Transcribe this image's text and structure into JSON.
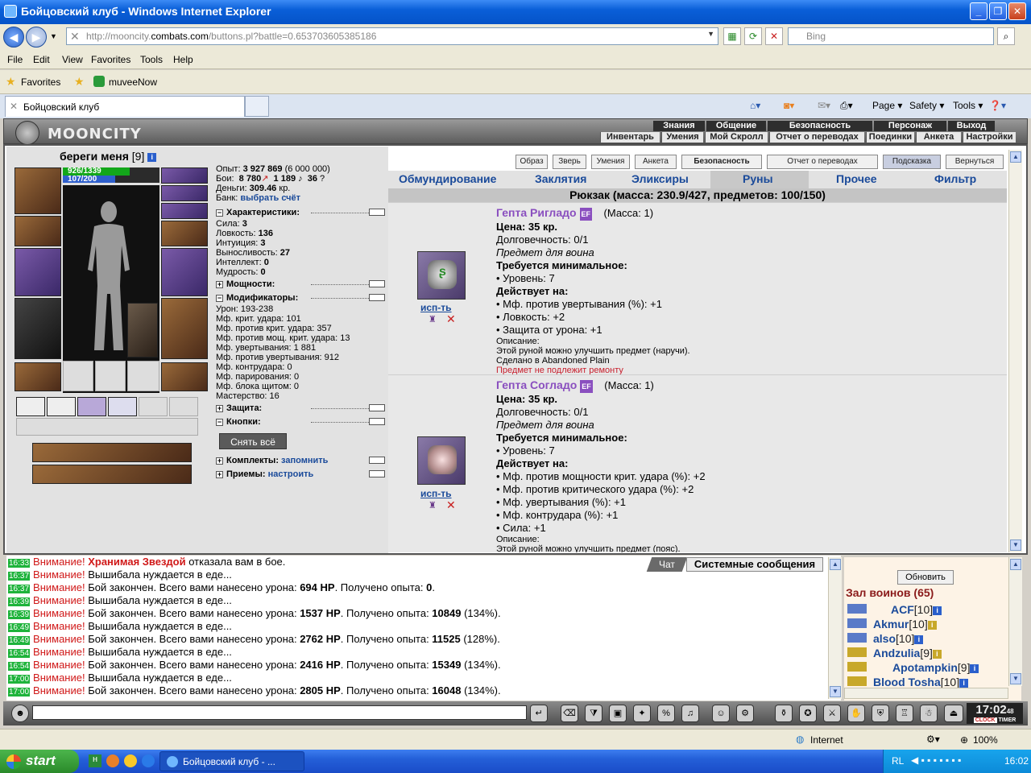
{
  "window": {
    "title": "Бойцовский клуб - Windows Internet Explorer",
    "min": "_",
    "max": "❐",
    "close": "✕"
  },
  "browser": {
    "url_prefix": "http://mooncity.",
    "url_domain": "combats.com",
    "url_suffix": "/buttons.pl?battle=0.653703605385186",
    "search_placeholder": "Bing",
    "menu": [
      "File",
      "Edit",
      "View",
      "Favorites",
      "Tools",
      "Help"
    ],
    "favorites_label": "Favorites",
    "fav_link": "muveeNow",
    "tab_title": "Бойцовский клуб",
    "cmd": [
      "Page ▾",
      "Safety ▾",
      "Tools ▾"
    ],
    "status_zone": "Internet",
    "zoom": "100%"
  },
  "game_header": {
    "logo": "MOONCITY",
    "top_menu": [
      "Знания",
      "Общение",
      "Безопасность",
      "Персонаж",
      "Выход"
    ],
    "sub_menu": [
      "Инвентарь",
      "Умения",
      "Отчет о переводах",
      "Анкета",
      "Настройки"
    ],
    "sub_menu2": [
      "Мой Скролл",
      "Поединки"
    ]
  },
  "character": {
    "nick": "береги меня",
    "level": "[9]",
    "hp": "926/1339",
    "mp": "107/200",
    "hp_fraction": 0.69,
    "mp_fraction": 0.54
  },
  "stats": {
    "exp_label": "Опыт:",
    "exp_value": "3 927 869",
    "exp_next": "(6 000 000)",
    "fights_label": "Бои:",
    "wins": "8 780",
    "losses": "1 189",
    "draws": "36",
    "money_label": "Деньги:",
    "money": "309.46",
    "money_unit": "кр.",
    "bank_label": "Банк:",
    "bank_link": "выбрать счёт",
    "sec_chars": "Характеристики:",
    "attrs": [
      {
        "label": "Сила:",
        "value": "3"
      },
      {
        "label": "Ловкость:",
        "value": "136"
      },
      {
        "label": "Интуиция:",
        "value": "3"
      },
      {
        "label": "Выносливость:",
        "value": "27"
      },
      {
        "label": "Интеллект:",
        "value": "0"
      },
      {
        "label": "Мудрость:",
        "value": "0"
      }
    ],
    "sec_power": "Мощности:",
    "sec_mods": "Модификаторы:",
    "mods": [
      "Урон: 193-238",
      "Мф. крит. удара: 101",
      "Мф. против крит. удара: 357",
      "Мф. против мощ. крит. удара: 13",
      "Мф. увертывания: 1 881",
      "Мф. против увертывания: 912",
      "Мф. контрудара: 0",
      "Мф. парирования: 0",
      "Мф. блока щитом: 0",
      "Мастерство: 16"
    ],
    "sec_defense": "Защита:",
    "sec_buttons": "Кнопки:",
    "takeoff": "Снять всё",
    "sec_sets": "Комплекты:",
    "sets_link": "запомнить",
    "sec_moves": "Приемы:",
    "moves_link": "настроить"
  },
  "top_buttons": [
    "Образ",
    "Зверь",
    "Умения",
    "Анкета",
    "Безопасность",
    "Отчет о переводах",
    "Подсказка",
    "Вернуться"
  ],
  "categories": [
    "Обмундирование",
    "Заклятия",
    "Эликсиры",
    "Руны",
    "Прочее",
    "Фильтр"
  ],
  "backpack": "Рюкзак (масса: 230.9/427, предметов: 100/150)",
  "items": [
    {
      "name": "Гепта Ригладо",
      "badge": "EF",
      "mass": "(Масса: 1)",
      "price": "Цена: 35 кр.",
      "durability": "Долговечность: 0/1",
      "for": "Предмет для воина",
      "req_head": "Требуется минимальное:",
      "req": [
        "• Уровень: 7"
      ],
      "acts_head": "Действует на:",
      "acts": [
        "• Мф. против увертывания (%): +1",
        "• Ловкость: +2",
        "• Защита от урона: +1"
      ],
      "desc_head": "Описание:",
      "desc": "Этой руной можно улучшить предмет (наручи).",
      "made": "Сделано в Abandoned Plain",
      "note": "Предмет не подлежит ремонту",
      "use": "исп-ть"
    },
    {
      "name": "Гепта Согладо",
      "badge": "EF",
      "mass": "(Масса: 1)",
      "price": "Цена: 35 кр.",
      "durability": "Долговечность: 0/1",
      "for": "Предмет для воина",
      "req_head": "Требуется минимальное:",
      "req": [
        "• Уровень: 7"
      ],
      "acts_head": "Действует на:",
      "acts": [
        "• Мф. против мощности крит. удара (%): +2",
        "• Мф. против критического удара (%): +2",
        "• Мф. увертывания (%): +1",
        "• Мф. контрудара (%): +1",
        "• Сила: +1"
      ],
      "desc_head": "Описание:",
      "desc": "Этой руной можно улучшить предмет (пояс).",
      "use": "исп-ть"
    }
  ],
  "chat": {
    "tab_chat": "Чат",
    "tab_system": "Системные сообщения",
    "messages": [
      {
        "time": "16:33",
        "warn": "Внимание!",
        "boss": "Хранимая Звездой",
        "text": " отказала вам в бое."
      },
      {
        "time": "16:37",
        "warn": "Внимание!",
        "text": " Вышибала нуждается в еде..."
      },
      {
        "time": "16:37",
        "warn": "Внимание!",
        "text": " Бой закончен. Всего вами нанесено урона: ",
        "dmg": "694 HP",
        "mid": ". Получено опыта: ",
        "exp": "0",
        "tail": "."
      },
      {
        "time": "16:39",
        "warn": "Внимание!",
        "text": " Вышибала нуждается в еде..."
      },
      {
        "time": "16:39",
        "warn": "Внимание!",
        "text": " Бой закончен. Всего вами нанесено урона: ",
        "dmg": "1537 HP",
        "mid": ". Получено опыта: ",
        "exp": "10849",
        "tail": " (134%)."
      },
      {
        "time": "16:49",
        "warn": "Внимание!",
        "text": " Вышибала нуждается в еде..."
      },
      {
        "time": "16:49",
        "warn": "Внимание!",
        "text": " Бой закончен. Всего вами нанесено урона: ",
        "dmg": "2762 HP",
        "mid": ". Получено опыта: ",
        "exp": "11525",
        "tail": " (128%)."
      },
      {
        "time": "16:54",
        "warn": "Внимание!",
        "text": " Вышибала нуждается в еде..."
      },
      {
        "time": "16:54",
        "warn": "Внимание!",
        "text": " Бой закончен. Всего вами нанесено урона: ",
        "dmg": "2416 HP",
        "mid": ". Получено опыта: ",
        "exp": "15349",
        "tail": " (134%)."
      },
      {
        "time": "17:00",
        "warn": "Внимание!",
        "text": " Вышибала нуждается в еде..."
      },
      {
        "time": "17:00",
        "warn": "Внимание!",
        "text": " Бой закончен. Всего вами нанесено урона: ",
        "dmg": "2805 HP",
        "mid": ". Получено опыта: ",
        "exp": "16048",
        "tail": " (134%)."
      }
    ]
  },
  "roster": {
    "refresh": "Обновить",
    "title": "Зал воинов (65)",
    "players": [
      {
        "name": "ACF",
        "level": "[10]"
      },
      {
        "name": "Akmur",
        "level": "[10]"
      },
      {
        "name": "also",
        "level": "[10]"
      },
      {
        "name": "Andzulia",
        "level": "[9]"
      },
      {
        "name": "Apotampkin",
        "level": "[9]"
      },
      {
        "name": "Blood Tosha",
        "level": "[10]"
      }
    ]
  },
  "clock": {
    "time": "17:02",
    "seconds": "48",
    "clock_label": "CLOCK",
    "timer_label": "TIMER"
  },
  "taskbar": {
    "start": "start",
    "task": "Бойцовский клуб - ...",
    "lang": "RL",
    "time": "16:02"
  }
}
